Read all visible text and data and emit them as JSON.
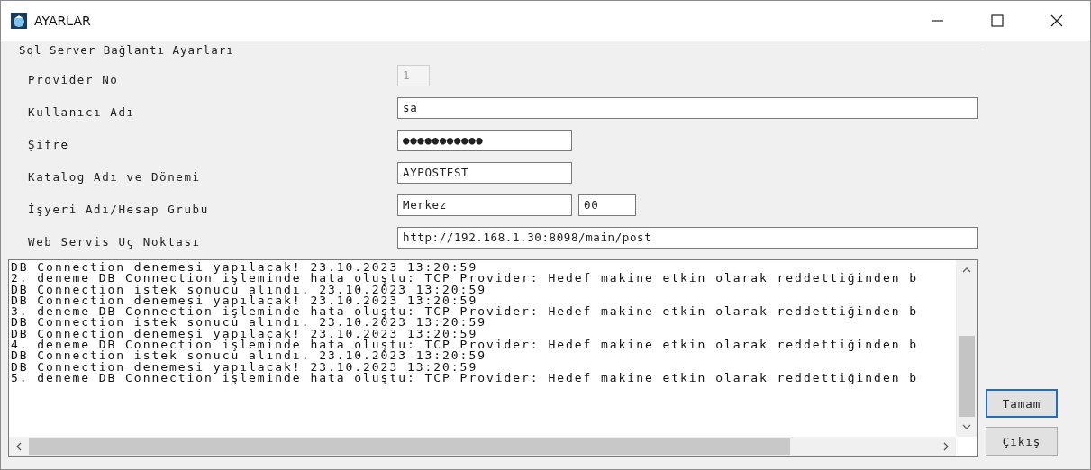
{
  "window": {
    "title": "AYARLAR"
  },
  "group": {
    "title": "Sql Server Bağlantı Ayarları"
  },
  "fields": [
    {
      "label": "Provider No",
      "inputs": [
        {
          "kind": "tiny",
          "value": "1",
          "disabled": true
        }
      ]
    },
    {
      "label": "Kullanıcı Adı",
      "inputs": [
        {
          "kind": "wide",
          "value": "sa",
          "disabled": false
        }
      ]
    },
    {
      "label": "Şifre",
      "inputs": [
        {
          "kind": "medium",
          "value": "●●●●●●●●●●●",
          "disabled": false
        }
      ]
    },
    {
      "label": "Katalog Adı ve Dönemi",
      "inputs": [
        {
          "kind": "medium",
          "value": "AYPOSTEST",
          "disabled": false
        }
      ]
    },
    {
      "label": "İşyeri Adı/Hesap Grubu",
      "inputs": [
        {
          "kind": "medium",
          "value": "Merkez",
          "disabled": false
        },
        {
          "kind": "small",
          "value": "00",
          "disabled": false
        }
      ]
    },
    {
      "label": "Web Servis Uç Noktası",
      "inputs": [
        {
          "kind": "wide",
          "value": "http://192.168.1.30:8098/main/post",
          "disabled": false
        }
      ]
    }
  ],
  "log": [
    "DB Connection denemesi yapılacak! 23.10.2023 13:20:59",
    "2. deneme DB Connection işleminde hata oluştu: TCP Provider: Hedef makine etkin olarak reddettiğinden b",
    "DB Connection istek sonucu alındı. 23.10.2023 13:20:59",
    "DB Connection denemesi yapılacak! 23.10.2023 13:20:59",
    "3. deneme DB Connection işleminde hata oluştu: TCP Provider: Hedef makine etkin olarak reddettiğinden b",
    "DB Connection istek sonucu alındı. 23.10.2023 13:20:59",
    "DB Connection denemesi yapılacak! 23.10.2023 13:20:59",
    "4. deneme DB Connection işleminde hata oluştu: TCP Provider: Hedef makine etkin olarak reddettiğinden b",
    "DB Connection istek sonucu alındı. 23.10.2023 13:20:59",
    "DB Connection denemesi yapılacak! 23.10.2023 13:20:59",
    "5. deneme DB Connection işleminde hata oluştu: TCP Provider: Hedef makine etkin olarak reddettiğinden b"
  ],
  "buttons": [
    {
      "label": "Tamam",
      "default": true
    },
    {
      "label": "Çıkış",
      "default": false
    }
  ]
}
